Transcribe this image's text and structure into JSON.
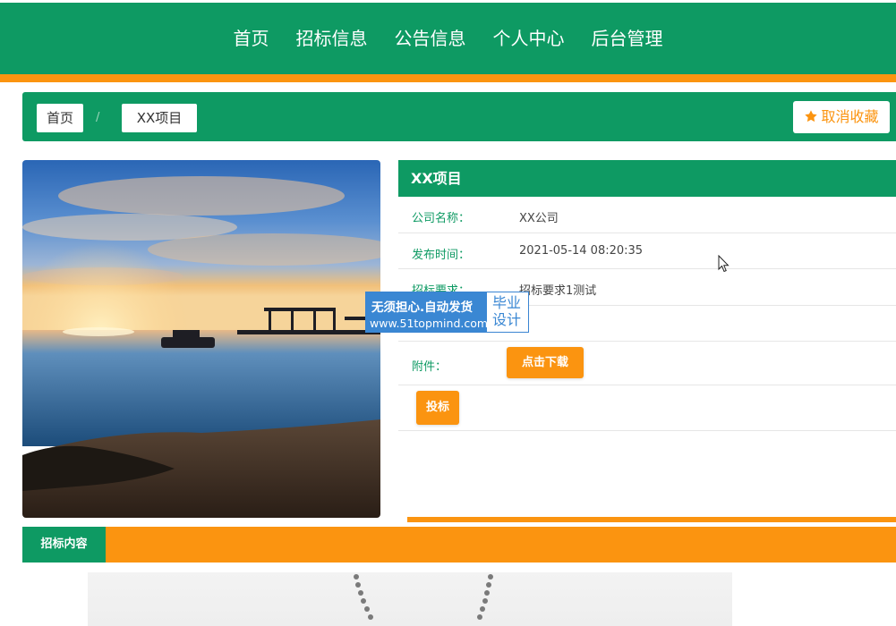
{
  "nav": {
    "items": [
      "首页",
      "招标信息",
      "公告信息",
      "个人中心",
      "后台管理"
    ]
  },
  "breadcrumb": {
    "home": "首页",
    "separator": "/",
    "current": "XX项目"
  },
  "favorite_button": "取消收藏",
  "project": {
    "title": "XX项目",
    "fields": [
      {
        "label": "公司名称：",
        "value": "XX公司"
      },
      {
        "label": "发布时间：",
        "value": "2021-05-14 08:20:35"
      },
      {
        "label": "招标要求：",
        "value": "招标要求1测试"
      }
    ],
    "attachment_label": "附件：",
    "download_button": "点击下载",
    "bid_button": "投标"
  },
  "watermark": {
    "line1": "无须担心.自动发货",
    "line2": "www.51topmind.com",
    "side1": "毕业",
    "side2": "设计"
  },
  "tabs": {
    "active": "招标内容"
  },
  "colors": {
    "green": "#0e9a63",
    "orange": "#fb9410",
    "watermark_blue": "#3a87d3"
  }
}
